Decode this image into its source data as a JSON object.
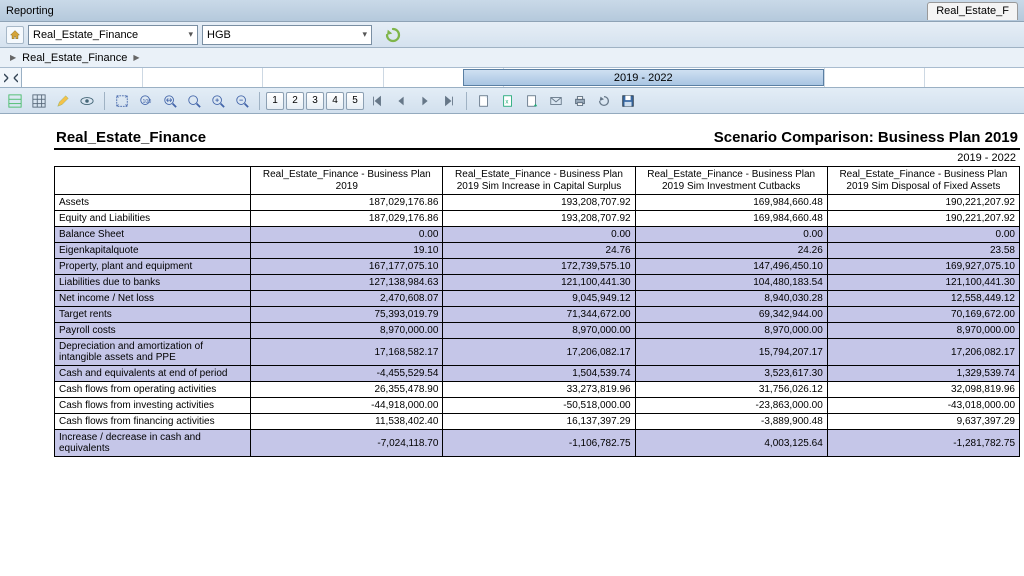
{
  "app_title": "Reporting",
  "tab_right": "Real_Estate_F",
  "selector": {
    "entity": "Real_Estate_Finance",
    "standard": "HGB"
  },
  "breadcrumb": [
    "Real_Estate_Finance"
  ],
  "timeline": {
    "active_label": "2019 - 2022"
  },
  "toolbar_numbers": [
    "1",
    "2",
    "3",
    "4",
    "5"
  ],
  "report": {
    "title": "Real_Estate_Finance",
    "subtitle": "Scenario Comparison: Business Plan 2019",
    "period": "2019 - 2022",
    "columns": [
      "Real_Estate_Finance - Business Plan 2019",
      "Real_Estate_Finance - Business Plan 2019\nSim Increase in Capital Surplus",
      "Real_Estate_Finance - Business Plan 2019\nSim Investment Cutbacks",
      "Real_Estate_Finance - Business Plan 2019\nSim Disposal of Fixed Assets"
    ],
    "rows": [
      {
        "label": "Assets",
        "shade": false,
        "vals": [
          "187,029,176.86",
          "193,208,707.92",
          "169,984,660.48",
          "190,221,207.92"
        ]
      },
      {
        "label": "Equity and Liabilities",
        "shade": false,
        "vals": [
          "187,029,176.86",
          "193,208,707.92",
          "169,984,660.48",
          "190,221,207.92"
        ]
      },
      {
        "label": "Balance Sheet",
        "shade": true,
        "vals": [
          "0.00",
          "0.00",
          "0.00",
          "0.00"
        ]
      },
      {
        "label": "Eigenkapitalquote",
        "shade": true,
        "vals": [
          "19.10",
          "24.76",
          "24.26",
          "23.58"
        ]
      },
      {
        "label": "Property, plant and equipment",
        "shade": true,
        "vals": [
          "167,177,075.10",
          "172,739,575.10",
          "147,496,450.10",
          "169,927,075.10"
        ]
      },
      {
        "label": "Liabilities due to banks",
        "shade": true,
        "vals": [
          "127,138,984.63",
          "121,100,441.30",
          "104,480,183.54",
          "121,100,441.30"
        ]
      },
      {
        "label": "Net income / Net loss",
        "shade": true,
        "vals": [
          "2,470,608.07",
          "9,045,949.12",
          "8,940,030.28",
          "12,558,449.12"
        ]
      },
      {
        "label": "Target rents",
        "shade": true,
        "vals": [
          "75,393,019.79",
          "71,344,672.00",
          "69,342,944.00",
          "70,169,672.00"
        ]
      },
      {
        "label": "Payroll costs",
        "shade": true,
        "vals": [
          "8,970,000.00",
          "8,970,000.00",
          "8,970,000.00",
          "8,970,000.00"
        ]
      },
      {
        "label": "Depreciation and amortization of intangible assets and PPE",
        "shade": true,
        "vals": [
          "17,168,582.17",
          "17,206,082.17",
          "15,794,207.17",
          "17,206,082.17"
        ]
      },
      {
        "label": "Cash and equivalents at end of period",
        "shade": true,
        "vals": [
          "-4,455,529.54",
          "1,504,539.74",
          "3,523,617.30",
          "1,329,539.74"
        ]
      },
      {
        "label": "Cash flows from operating activities",
        "shade": false,
        "vals": [
          "26,355,478.90",
          "33,273,819.96",
          "31,756,026.12",
          "32,098,819.96"
        ]
      },
      {
        "label": "Cash flows from investing activities",
        "shade": false,
        "vals": [
          "-44,918,000.00",
          "-50,518,000.00",
          "-23,863,000.00",
          "-43,018,000.00"
        ]
      },
      {
        "label": "Cash flows from financing activities",
        "shade": false,
        "vals": [
          "11,538,402.40",
          "16,137,397.29",
          "-3,889,900.48",
          "9,637,397.29"
        ]
      },
      {
        "label": "Increase / decrease in cash and equivalents",
        "shade": true,
        "vals": [
          "-7,024,118.70",
          "-1,106,782.75",
          "4,003,125.64",
          "-1,281,782.75"
        ]
      }
    ]
  }
}
